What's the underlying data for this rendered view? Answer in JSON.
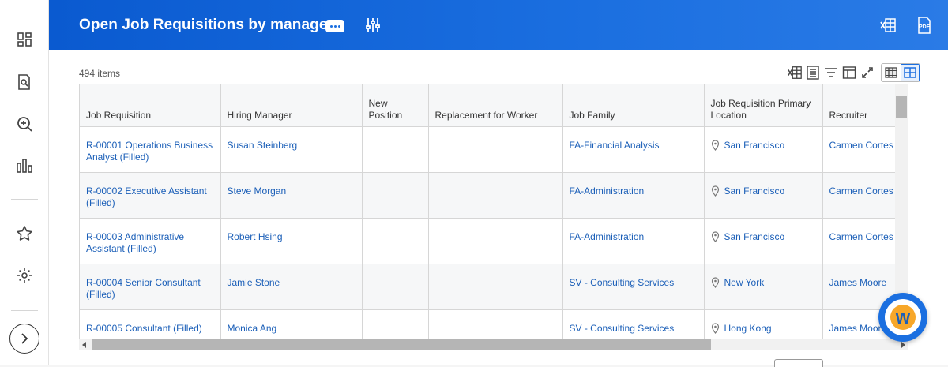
{
  "header": {
    "title": "Open Job Requisitions by manager",
    "accent_color": "#1b6fe0",
    "icons": [
      "more-options-icon",
      "filter-sliders-icon",
      "export-excel-icon",
      "export-pdf-icon"
    ]
  },
  "sidebar": {
    "icons": [
      "dashboard-icon",
      "report-search-icon",
      "search-zoom-icon",
      "bar-chart-icon",
      "star-icon",
      "gear-icon",
      "chevron-right-icon"
    ]
  },
  "report": {
    "items_count": "494 items",
    "columns": [
      "Job Requisition",
      "Hiring Manager",
      "New Position",
      "Replacement for Worker",
      "Job Family",
      "Job Requisition Primary Location",
      "Recruiter"
    ],
    "rows": [
      {
        "req": "R-00001 Operations Business Analyst (Filled)",
        "manager": "Susan Steinberg",
        "new_position": "",
        "replacement": "",
        "family": "FA-Financial Analysis",
        "location": "San Francisco",
        "recruiter": "Carmen Cortes"
      },
      {
        "req": "R-00002 Executive Assistant (Filled)",
        "manager": "Steve Morgan",
        "new_position": "",
        "replacement": "",
        "family": "FA-Administration",
        "location": "San Francisco",
        "recruiter": "Carmen Cortes"
      },
      {
        "req": "R-00003 Administrative Assistant (Filled)",
        "manager": "Robert Hsing",
        "new_position": "",
        "replacement": "",
        "family": "FA-Administration",
        "location": "San Francisco",
        "recruiter": "Carmen Cortes"
      },
      {
        "req": "R-00004 Senior Consultant (Filled)",
        "manager": "Jamie Stone",
        "new_position": "",
        "replacement": "",
        "family": "SV - Consulting Services",
        "location": "New York",
        "recruiter": "James Moore"
      },
      {
        "req": "R-00005 Consultant (Filled)",
        "manager": "Monica Ang",
        "new_position": "",
        "replacement": "",
        "family": "SV - Consulting Services",
        "location": "Hong Kong",
        "recruiter": "James Moore"
      }
    ]
  },
  "assistant": {
    "glyph": "W"
  }
}
